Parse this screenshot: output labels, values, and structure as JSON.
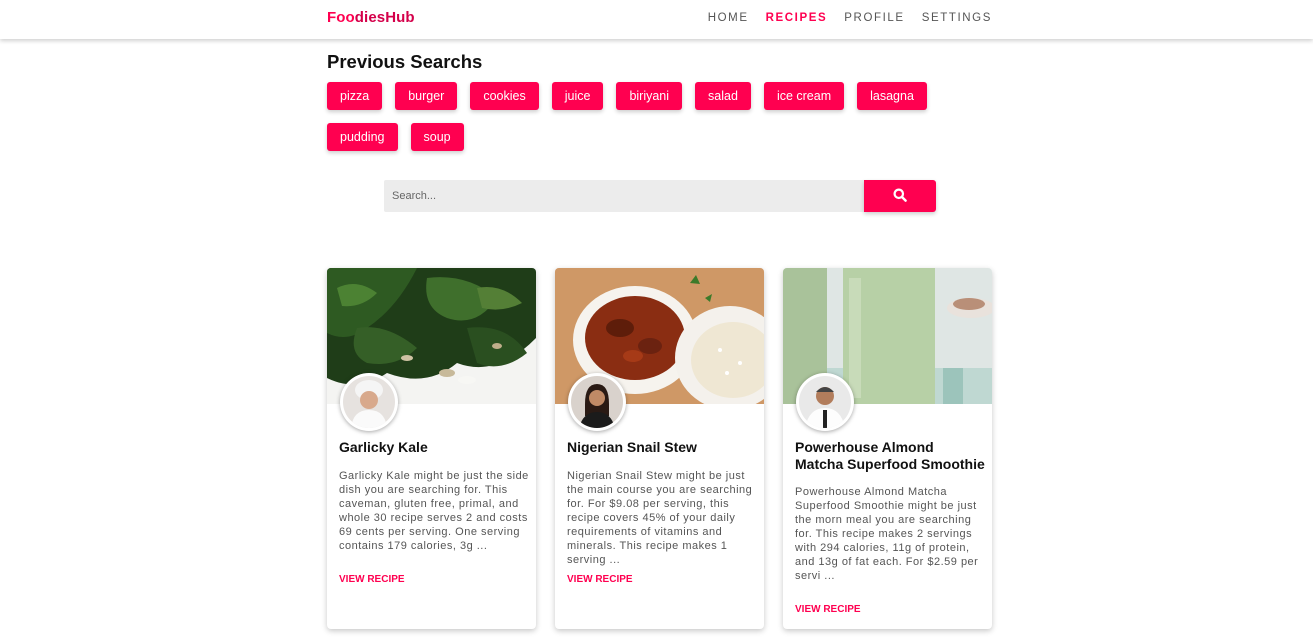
{
  "nav": {
    "brand_part1": "Foo",
    "brand_part2": "diesHub",
    "links": [
      {
        "label": "HOME",
        "active": false
      },
      {
        "label": "RECIPES",
        "active": true
      },
      {
        "label": "PROFILE",
        "active": false
      },
      {
        "label": "SETTINGS",
        "active": false
      }
    ]
  },
  "previous_searches": {
    "title": "Previous Searchs",
    "items": [
      "pizza",
      "burger",
      "cookies",
      "juice",
      "biriyani",
      "salad",
      "ice cream",
      "lasagna",
      "pudding",
      "soup"
    ]
  },
  "search": {
    "placeholder": "Search...",
    "icon": "search-icon"
  },
  "recipes": [
    {
      "title": "Garlicky Kale",
      "description": "Garlicky Kale might be just the side dish you are searching for. This caveman, gluten free, primal, and whole 30 recipe serves 2 and costs 69 cents per serving. One serving contains 179 calories, 3g ...",
      "link_label": "VIEW RECIPE",
      "image": "kale-photo",
      "avatar": "chef-avatar"
    },
    {
      "title": "Nigerian Snail Stew",
      "description": "Nigerian Snail Stew might be just the main course you are searching for. For $9.08 per serving, this recipe covers 45% of your daily requirements of vitamins and minerals. This recipe makes 1 serving ...",
      "link_label": "VIEW RECIPE",
      "image": "stew-photo",
      "avatar": "chef-avatar"
    },
    {
      "title": "Powerhouse Almond Matcha Superfood Smoothie",
      "description": "Powerhouse Almond Matcha Superfood Smoothie might be just the morn meal you are searching for. This recipe makes 2 servings with 294 calories, 11g of protein, and 13g of fat each. For $2.59 per servi ...",
      "link_label": "VIEW RECIPE",
      "image": "smoothie-photo",
      "avatar": "chef-avatar"
    }
  ],
  "colors": {
    "accent": "#ff0050",
    "search_bg": "#ececec"
  }
}
